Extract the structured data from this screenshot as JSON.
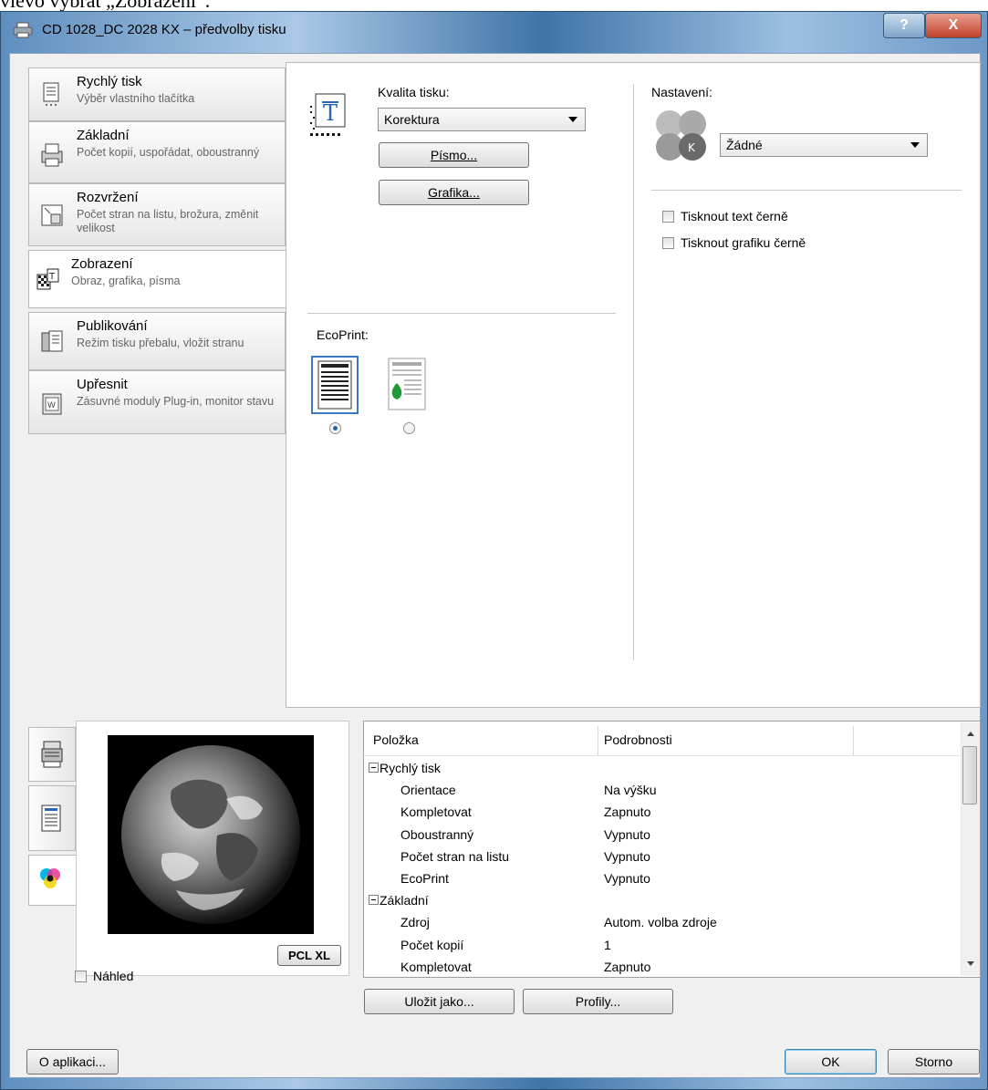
{
  "caption_above": "vlevo vybrat „Zobrazení“.",
  "window": {
    "title": "CD 1028_DC 2028 KX – předvolby tisku",
    "help_label": "?",
    "close_label": "X"
  },
  "sidebar": {
    "items": [
      {
        "title": "Rychlý tisk",
        "desc": "Výběr vlastního tlačítka",
        "icon": "quick-print-icon"
      },
      {
        "title": "Základní",
        "desc": "Počet kopií, uspořádat, oboustranný",
        "icon": "basic-icon"
      },
      {
        "title": "Rozvržení",
        "desc": "Počet stran na listu, brožura, změnit velikost",
        "icon": "layout-icon"
      },
      {
        "title": "Zobrazení",
        "desc": "Obraz, grafika, písma",
        "icon": "imaging-icon",
        "active": true
      },
      {
        "title": "Publikování",
        "desc": "Režim tisku přebalu, vložit stranu",
        "icon": "publishing-icon"
      },
      {
        "title": "Upřesnit",
        "desc": "Zásuvné moduly Plug-in, monitor stavu",
        "icon": "advanced-icon"
      }
    ]
  },
  "imaging": {
    "quality_label": "Kvalita tisku:",
    "quality_value": "Korektura",
    "font_button": "Písmo...",
    "graphics_button": "Grafika...",
    "ecoprint_label": "EcoPrint:",
    "ecoprint_selected": "off"
  },
  "color_settings": {
    "label": "Nastavení:",
    "value": "Žádné",
    "k_badge": "K",
    "print_text_black": "Tisknout text černě",
    "print_graphics_black": "Tisknout grafiku černě"
  },
  "preview": {
    "badge": "PCL XL"
  },
  "summary": {
    "headers": [
      "Položka",
      "Podrobnosti"
    ],
    "groups": [
      {
        "name": "Rychlý tisk",
        "rows": [
          [
            "Orientace",
            "Na výšku"
          ],
          [
            "Kompletovat",
            "Zapnuto"
          ],
          [
            "Oboustranný",
            "Vypnuto"
          ],
          [
            "Počet stran na listu",
            "Vypnuto"
          ],
          [
            "EcoPrint",
            "Vypnuto"
          ]
        ]
      },
      {
        "name": "Základní",
        "rows": [
          [
            "Zdroj",
            "Autom. volba zdroje"
          ],
          [
            "Počet kopií",
            "1"
          ],
          [
            "Kompletovat",
            "Zapnuto"
          ]
        ]
      }
    ]
  },
  "bottom": {
    "preview_checkbox": "Náhled",
    "save_as": "Uložit jako...",
    "profiles": "Profily...",
    "about": "O aplikaci...",
    "ok": "OK",
    "cancel": "Storno"
  }
}
